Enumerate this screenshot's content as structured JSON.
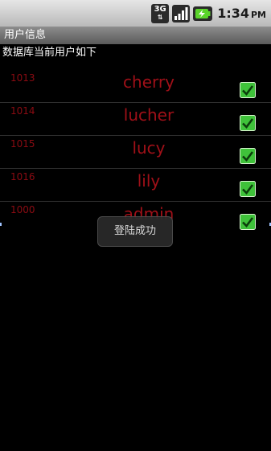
{
  "status_bar": {
    "network": "3G",
    "clock": "1:34",
    "ampm": "PM"
  },
  "title_bar": {
    "title": "用户信息"
  },
  "content": {
    "subtitle": "数据库当前用户如下",
    "users": [
      {
        "id": "1013",
        "name": "cherry",
        "checked": true
      },
      {
        "id": "1014",
        "name": "lucher",
        "checked": true
      },
      {
        "id": "1015",
        "name": "lucy",
        "checked": true
      },
      {
        "id": "1016",
        "name": "lily",
        "checked": true
      },
      {
        "id": "1000",
        "name": "admin",
        "checked": true
      }
    ]
  },
  "toast": {
    "message": "登陆成功"
  },
  "colors": {
    "text_red": "#a01018",
    "id_red": "#8b0b12",
    "checkbox_green": "#3fc23a"
  }
}
